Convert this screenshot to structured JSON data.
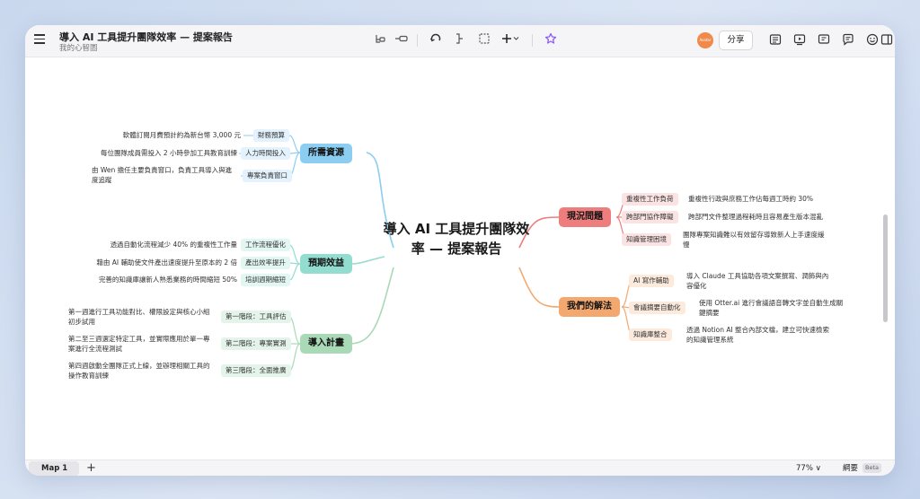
{
  "header": {
    "title": "導入 AI 工具提升團隊效率 — 提案報告",
    "subtitle": "我的心智圖",
    "avatar_text": "Avatar",
    "share_label": "分享"
  },
  "toolbar": {
    "icons": [
      "subtopic-icon",
      "topic-icon",
      "undo-icon",
      "boundary-icon",
      "summary-icon",
      "insert-icon",
      "ai-sparkle-icon"
    ]
  },
  "mindmap": {
    "central": "導入 AI 工具提升團隊效率 — 提案報告",
    "branches": {
      "resources": {
        "label": "所需資源",
        "color": "#8ccdf2",
        "subs": [
          {
            "label": "財務預算",
            "leaf": "軟體訂閱月費預計約為新台幣 3,000 元"
          },
          {
            "label": "人力時間投入",
            "leaf": "每位團隊成員需投入 2 小時參加工具教育訓練"
          },
          {
            "label": "專案負責窗口",
            "leaf_lines": [
              "由 Wen 擔任主要負責窗口，負責工具導入與進",
              "度追蹤"
            ]
          }
        ]
      },
      "benefits": {
        "label": "預期效益",
        "color": "#93dcd0",
        "subs": [
          {
            "label": "工作流程優化",
            "leaf": "透過自動化流程減少 40% 的重複性工作量"
          },
          {
            "label": "產出效率提升",
            "leaf": "藉由 AI 輔助使文件產出速度提升至原本的 2 倍"
          },
          {
            "label": "培訓週期縮短",
            "leaf": "完善的知識庫讓新人熟悉業務的時間縮短 50%"
          }
        ]
      },
      "plan": {
        "label": "導入計畫",
        "color": "#a9d9b6",
        "subs": [
          {
            "label": "第一階段：工具評估",
            "leaf_lines": [
              "第一週進行工具功能對比、權限設定與核心小組",
              "初步試用"
            ]
          },
          {
            "label": "第二階段：專案實測",
            "leaf_lines": [
              "第二至三週選定特定工具，並實際應用於單一專",
              "案進行全流程測試"
            ]
          },
          {
            "label": "第三階段：全面推廣",
            "leaf_lines": [
              "第四週啟動全團隊正式上線，並辦理相關工具的",
              "操作教育訓練"
            ]
          }
        ]
      },
      "problems": {
        "label": "現況問題",
        "color": "#ee7d7d",
        "subs": [
          {
            "label": "重複性工作負荷",
            "leaf": "重複性行政與庶務工作佔每週工時約 30%"
          },
          {
            "label": "跨部門協作障礙",
            "leaf": "跨部門文件整理過程耗時且容易產生版本混亂"
          },
          {
            "label": "知識管理困境",
            "leaf_lines": [
              "團隊專案知識難以有效留存導致新人上手速度緩",
              "慢"
            ]
          }
        ]
      },
      "solutions": {
        "label": "我們的解法",
        "color": "#f2a86f",
        "subs": [
          {
            "label": "AI 寫作輔助",
            "leaf_lines": [
              "導入 Claude 工具協助各項文案撰寫、潤飾與內",
              "容優化"
            ]
          },
          {
            "label": "會議摘要自動化",
            "leaf_lines": [
              "使用 Otter.ai 進行會議語音轉文字並自動生成關",
              "鍵摘要"
            ]
          },
          {
            "label": "知識庫整合",
            "leaf_lines": [
              "透過 Notion AI 整合內部文檔，建立可快速檢索",
              "的知識管理系統"
            ]
          }
        ]
      }
    }
  },
  "footer": {
    "tab_label": "Map 1",
    "add_label": "+",
    "zoom_label": "77% ∨",
    "outline_label": "綱要",
    "beta_label": "Beta"
  }
}
